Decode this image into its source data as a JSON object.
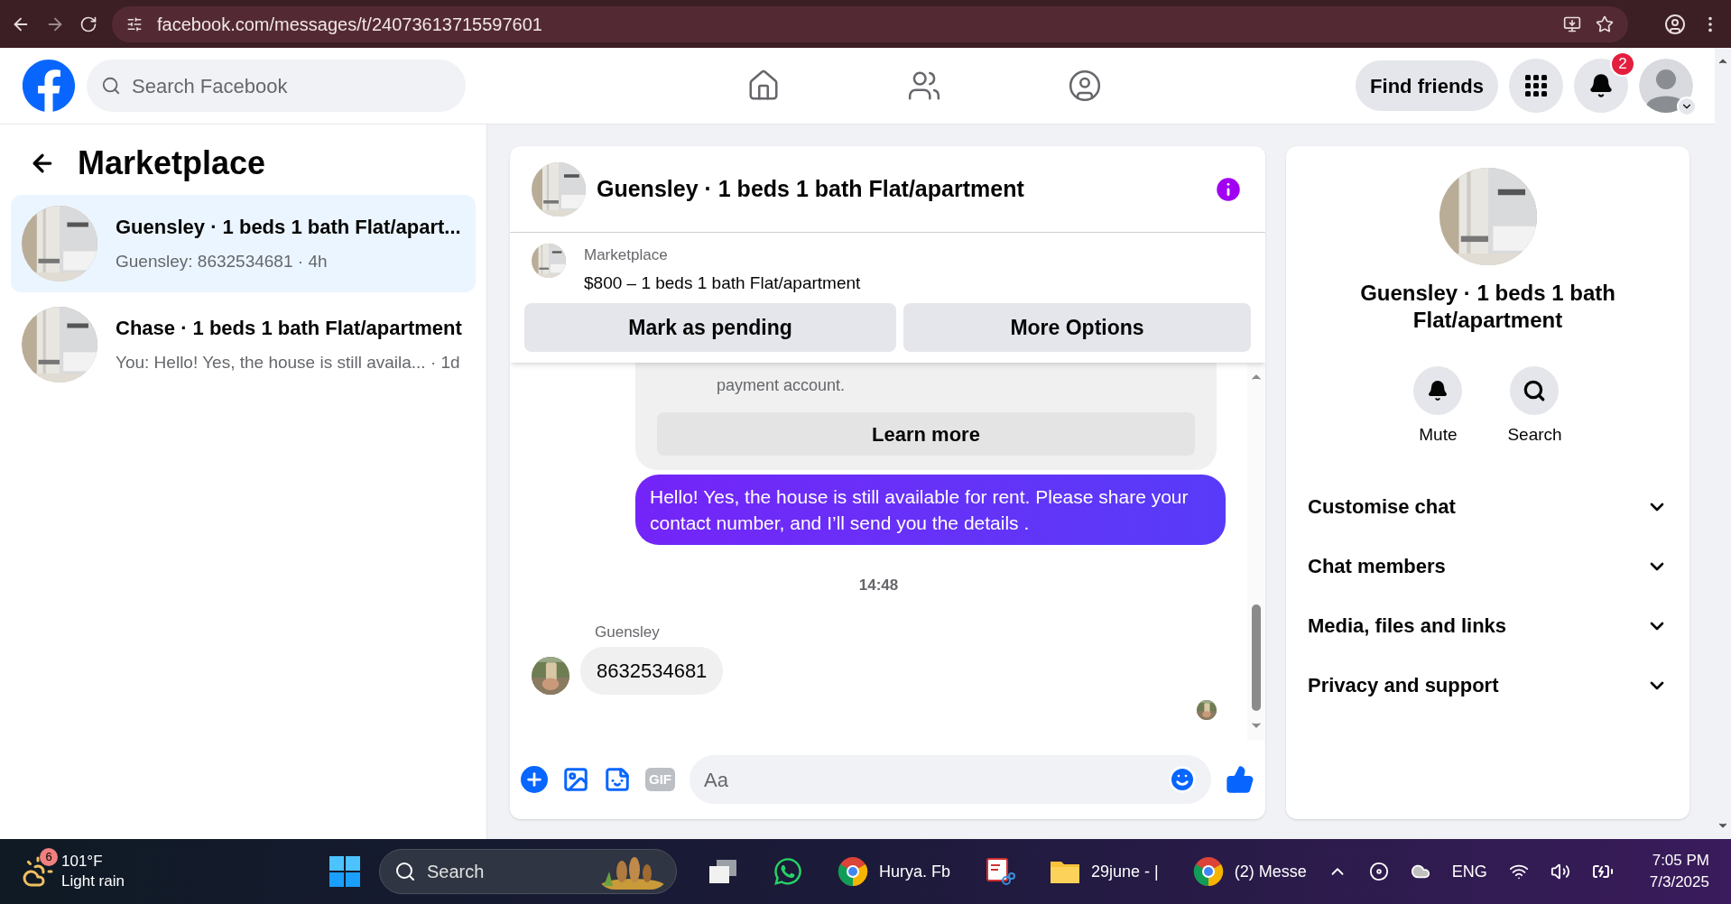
{
  "browser": {
    "url": "facebook.com/messages/t/24073613715597601"
  },
  "header": {
    "search": {
      "placeholder": "Search Facebook"
    },
    "find_friends": "Find friends",
    "notifications_badge": "2"
  },
  "sidebar": {
    "title": "Marketplace",
    "conversations": [
      {
        "title": "Guensley · 1 beds 1 bath Flat/apart...",
        "preview": "Guensley: 8632534681 · 4h",
        "selected": true
      },
      {
        "title": "Chase · 1 beds 1 bath Flat/apartment",
        "preview": "You: Hello! Yes, the house is still availa... · 1d",
        "selected": false
      }
    ]
  },
  "chat": {
    "title": "Guensley · 1 beds 1 bath Flat/apartment",
    "listing": {
      "source": "Marketplace",
      "price_title": "$800 – 1 beds 1 bath Flat/apartment",
      "buttons": [
        "Mark as pending",
        "More Options"
      ]
    },
    "notice": {
      "text": "payment account.",
      "button": "Learn more"
    },
    "messages": [
      {
        "kind": "outgoing",
        "text": "Hello! Yes, the house is still available for rent. Please share your contact number, and I’ll send you the details ."
      },
      {
        "kind": "timestamp",
        "text": "14:48"
      },
      {
        "kind": "incoming",
        "sender": "Guensley",
        "text": "8632534681"
      }
    ],
    "composer": {
      "gif_label": "GIF",
      "placeholder": "Aa"
    }
  },
  "details": {
    "title": "Guensley · 1 beds 1 bath Flat/apartment",
    "actions": [
      {
        "kind": "mute",
        "label": "Mute"
      },
      {
        "kind": "search",
        "label": "Search"
      }
    ],
    "sections": [
      {
        "label": "Customise chat",
        "expanded": false
      },
      {
        "label": "Chat members",
        "expanded": false
      },
      {
        "label": "Media, files and links",
        "expanded": false
      },
      {
        "label": "Privacy and support",
        "expanded": false
      }
    ]
  },
  "taskbar": {
    "weather": {
      "badge": "6",
      "temperature": "101°F",
      "condition": "Light rain"
    },
    "search": {
      "placeholder": "Search"
    },
    "apps": [
      {
        "kind": "taskview"
      },
      {
        "kind": "whatsapp"
      },
      {
        "kind": "chrome",
        "label": "Hurya. Fb"
      },
      {
        "kind": "snip"
      },
      {
        "kind": "folder",
        "label": "29june - |"
      },
      {
        "kind": "chrome",
        "label": "(2) Messe"
      }
    ],
    "language": "ENG",
    "time": "7:05 PM",
    "date": "7/3/2025"
  }
}
